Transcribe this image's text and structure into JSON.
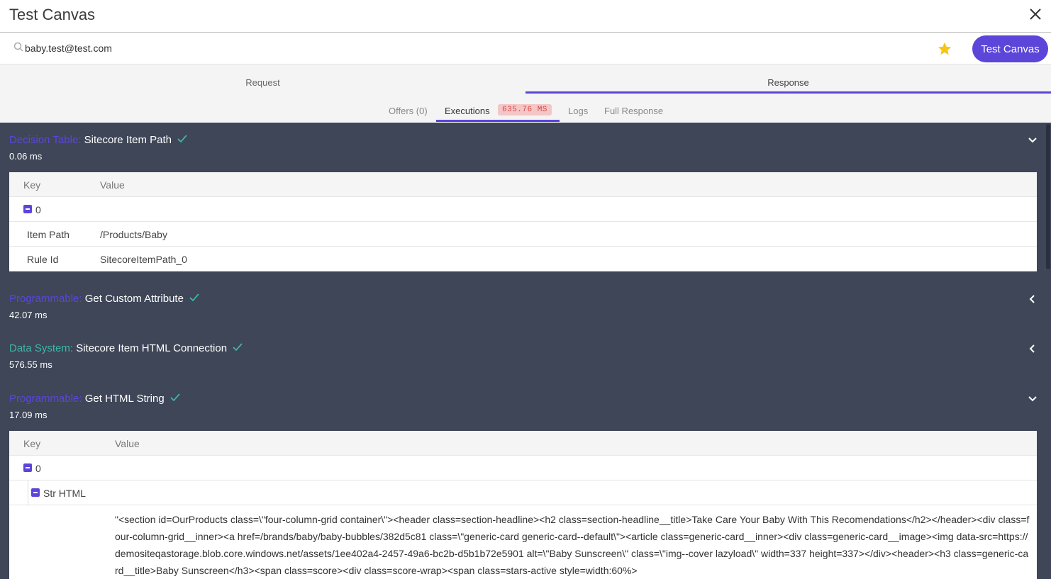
{
  "header": {
    "title": "Test Canvas",
    "close_icon": "close-icon"
  },
  "search": {
    "value": "baby.test@test.com",
    "icon": "search-icon"
  },
  "toolbar": {
    "favorite_icon": "star-icon",
    "favorite_color": "#f5c518",
    "run_label": "Test Canvas",
    "accent": "#5b46d9"
  },
  "tabs": {
    "request": "Request",
    "response": "Response",
    "sub": {
      "offers": "Offers (0)",
      "executions": "Executions",
      "executions_time": "635.76 MS",
      "logs": "Logs",
      "full_response": "Full Response"
    }
  },
  "executions": [
    {
      "kind": "Decision Table:",
      "name": "Sitecore Item Path",
      "time": "0.06 ms",
      "expanded": true,
      "table": {
        "key_header": "Key",
        "value_header": "Value",
        "group": "0",
        "rows": [
          {
            "key": "Item Path",
            "value": "/Products/Baby"
          },
          {
            "key": "Rule Id",
            "value": "SitecoreItemPath_0"
          }
        ]
      }
    },
    {
      "kind": "Programmable:",
      "name": "Get Custom Attribute",
      "time": "42.07 ms",
      "expanded": false
    },
    {
      "kind": "Data System:",
      "name": "Sitecore Item HTML Connection",
      "time": "576.55 ms",
      "expanded": false
    },
    {
      "kind": "Programmable:",
      "name": "Get HTML String",
      "time": "17.09 ms",
      "expanded": true,
      "table": {
        "key_header": "Key",
        "value_header": "Value",
        "group": "0",
        "subgroup": "Str HTML",
        "html_value": "\"<section id=OurProducts class=\\\"four-column-grid container\\\"><header class=section-headline><h2 class=section-headline__title>Take Care Your Baby With This Recomendations</h2></header><div class=four-column-grid__inner><a href=/brands/baby/baby-bubbles/382d5c81 class=\\\"generic-card generic-card--default\\\"><article class=generic-card__inner><div class=generic-card__image><img data-src=https://demositeqastorage.blob.core.windows.net/assets/1ee402a4-2457-49a6-bc2b-d5b1b72e5901 alt=\\\"Baby Sunscreen\\\" class=\\\"img--cover lazyload\\\" width=337 height=337></div><header><h3 class=generic-card__title>Baby Sunscreen</h3><span class=score><div class=score-wrap><span class=stars-active style=width:60%>"
      }
    }
  ]
}
